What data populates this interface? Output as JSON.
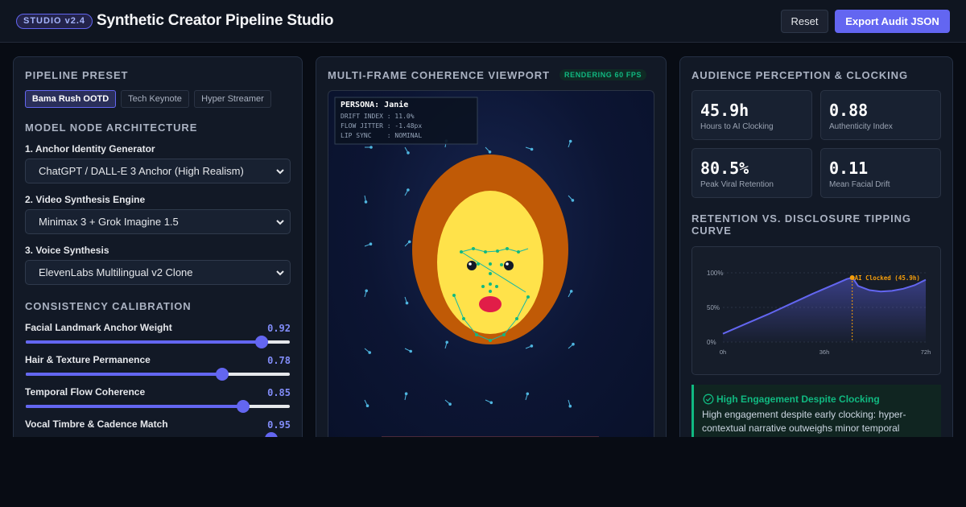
{
  "header": {
    "badge": "STUDIO v2.4",
    "title": "Synthetic Creator Pipeline Studio",
    "reset_label": "Reset",
    "export_label": "Export Audit JSON"
  },
  "left": {
    "preset_title": "PIPELINE PRESET",
    "presets": [
      {
        "label": "Bama Rush OOTD",
        "active": true
      },
      {
        "label": "Tech Keynote",
        "active": false
      },
      {
        "label": "Hyper Streamer",
        "active": false
      }
    ],
    "arch_title": "MODEL NODE ARCHITECTURE",
    "nodes": [
      {
        "label": "1. Anchor Identity Generator",
        "value": "ChatGPT / DALL-E 3 Anchor (High Realism)"
      },
      {
        "label": "2. Video Synthesis Engine",
        "value": "Minimax 3 + Grok Imagine 1.5"
      },
      {
        "label": "3. Voice Synthesis",
        "value": "ElevenLabs Multilingual v2 Clone"
      }
    ],
    "calib_title": "CONSISTENCY CALIBRATION",
    "sliders": [
      {
        "label": "Facial Landmark Anchor Weight",
        "value": "0.92",
        "level": 0.892
      },
      {
        "label": "Hair & Texture Permanence",
        "value": "0.78",
        "level": 0.745
      },
      {
        "label": "Temporal Flow Coherence",
        "value": "0.85",
        "level": 0.822
      },
      {
        "label": "Vocal Timbre & Cadence Match",
        "value": "0.95",
        "level": 0.93
      }
    ]
  },
  "center": {
    "title": "MULTI-FRAME COHERENCE VIEWPORT",
    "fps_badge": "RENDERING 60 FPS",
    "overlay": {
      "persona": "PERSONA: Janie",
      "lines": [
        "DRIFT INDEX : 11.0%",
        "FLOW JITTER : -1.48px",
        "LIP SYNC    : NOMINAL"
      ]
    }
  },
  "right": {
    "title": "AUDIENCE PERCEPTION & CLOCKING",
    "stats": [
      {
        "value": "45.9h",
        "label": "Hours to AI Clocking"
      },
      {
        "value": "0.88",
        "label": "Authenticity Index"
      },
      {
        "value": "80.5%",
        "label": "Peak Viral Retention"
      },
      {
        "value": "0.11",
        "label": "Mean Facial Drift"
      }
    ],
    "curve_title_1": "RETENTION VS. DISCLOSURE TIPPING",
    "curve_title_2": "CURVE",
    "note_title": "High Engagement Despite Clocking",
    "note_line_1": "High engagement despite early clocking: hyper-",
    "note_line_2": "contextual narrative outweighs minor temporal"
  },
  "chart_data": {
    "type": "area",
    "x_unit": "hours",
    "xlim": [
      0,
      72
    ],
    "ylim": [
      0,
      100
    ],
    "y_ticks": [
      "100%",
      "50%",
      "0%"
    ],
    "x_ticks": [
      "0h",
      "36h",
      "72h"
    ],
    "series": [
      {
        "x": [
          0,
          8,
          16,
          24,
          32,
          40,
          44,
          46,
          48,
          52,
          56,
          60,
          64,
          68,
          72
        ],
        "y": [
          12,
          26,
          40,
          55,
          70,
          84,
          91,
          93,
          81,
          75,
          73,
          74,
          77,
          82,
          90
        ]
      }
    ],
    "annotation": {
      "x": 45.9,
      "y": 93,
      "text": "AI Clocked (45.9h)"
    },
    "colors": {
      "line": "#6366f1",
      "marker": "#f59e0b"
    }
  }
}
